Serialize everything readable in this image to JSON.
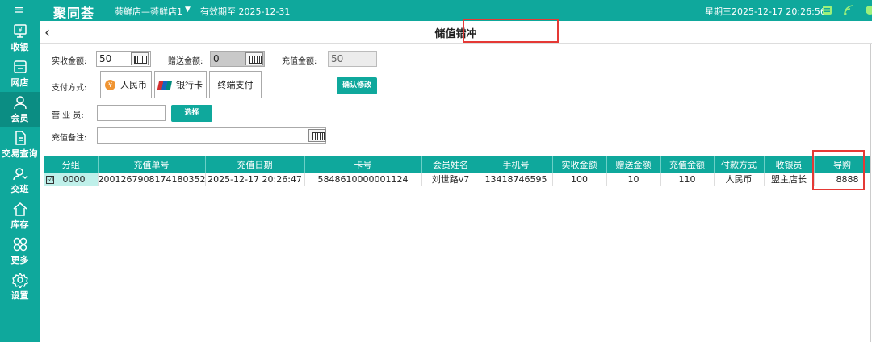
{
  "topbar": {
    "menu_glyph": "≡",
    "logo": "聚同荟",
    "store": "荟鲜店—荟鲜店1",
    "validity": "有效期至 2025-12-31",
    "datetime": "星期三2025-12-17 20:26:56"
  },
  "sidebar": {
    "items": [
      {
        "label": "收银",
        "icon": "cash-register-icon"
      },
      {
        "label": "网店",
        "icon": "shop-icon"
      },
      {
        "label": "会员",
        "icon": "member-icon"
      },
      {
        "label": "交易查询",
        "icon": "document-icon"
      },
      {
        "label": "交班",
        "icon": "shift-icon"
      },
      {
        "label": "库存",
        "icon": "house-icon"
      },
      {
        "label": "更多",
        "icon": "grid-icon"
      },
      {
        "label": "设置",
        "icon": "gear-icon"
      }
    ],
    "active_index": 2
  },
  "page": {
    "back_glyph": "‹",
    "title": "储值错冲"
  },
  "form": {
    "actual_label": "实收金额:",
    "actual_value": "50",
    "gift_label": "赠送金额:",
    "gift_value": "0",
    "recharge_label": "充值金额:",
    "recharge_value": "50",
    "pay_label": "支付方式:",
    "pay_methods": [
      "人民币",
      "银行卡",
      "终端支付"
    ],
    "rmb_coin": "¥",
    "confirm_label": "确认修改",
    "staff_label": "营 业 员:",
    "staff_value": "",
    "select_label": "选择",
    "remark_label": "充值备注:",
    "remark_value": ""
  },
  "table": {
    "columns": [
      "分组",
      "充值单号",
      "充值日期",
      "卡号",
      "会员姓名",
      "手机号",
      "实收金额",
      "赠送金额",
      "充值金额",
      "付款方式",
      "收银员",
      "导购"
    ],
    "rows": [
      {
        "checked": "☑",
        "cells": [
          "0000",
          "2001267908174180352",
          "2025-12-17 20:26:47",
          "5848610000001124",
          "刘世路v7",
          "13418746595",
          "100",
          "10",
          "110",
          "人民币",
          "盟主店长",
          "8888"
        ]
      }
    ]
  },
  "colors": {
    "accent": "#0fa89c",
    "active_nav": "#0b8d83",
    "highlight": "#e53935"
  }
}
